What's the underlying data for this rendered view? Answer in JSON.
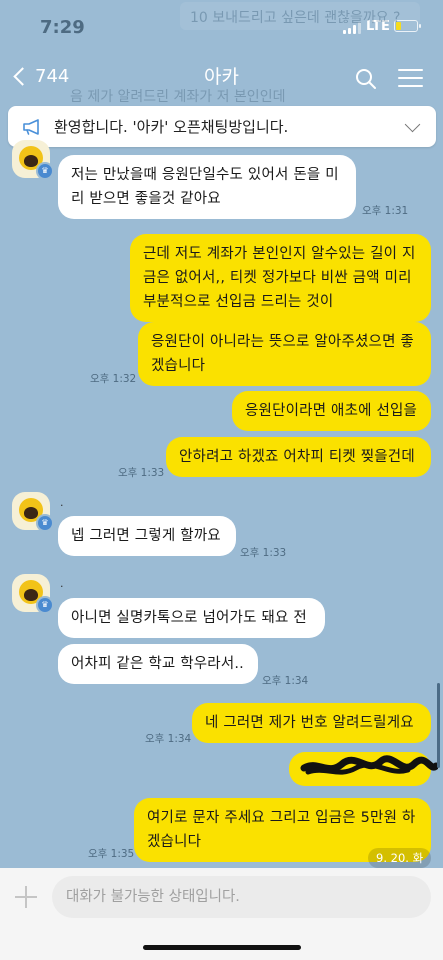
{
  "status_bar": {
    "time": "7:29",
    "network": "LTE"
  },
  "background_ghost": {
    "top_text": "10 보내드리고 싶은데 괜찮을까요 ?",
    "mid_text": "음 제가 알려드린 계좌가 저 본인인데"
  },
  "nav": {
    "back_count": "744",
    "title": "아카"
  },
  "notice": {
    "text": "환영합니다. '아카' 오픈채팅방입니다."
  },
  "messages": {
    "m1": {
      "text": "저는 만났을때 응원단일수도 있어서 돈을 미리 받으면 좋을것 같아요",
      "time": "오후 1:31"
    },
    "m2": {
      "text": "근데 저도 계좌가 본인인지 알수있는 길이 지금은 없어서,, 티켓 정가보다 비싼 금액 미리 부분적으로 선입금 드리는 것이"
    },
    "m3": {
      "text": "응원단이 아니라는 뜻으로 알아주셨으면 좋겠습니다",
      "time": "오후 1:32"
    },
    "m4": {
      "text": "응원단이라면 애초에 선입을"
    },
    "m5": {
      "text": "안하려고 하겠죠 어차피 티켓 찢을건데",
      "time": "오후 1:33"
    },
    "m6": {
      "sender": ".",
      "text": "넵 그러면 그렇게 할까요",
      "time": "오후 1:33"
    },
    "m7": {
      "sender": ".",
      "text": "아니면 실명카톡으로 넘어가도 돼요 전"
    },
    "m8": {
      "text": "어차피 같은 학교 학우라서..",
      "time": "오후 1:34"
    },
    "m9": {
      "text": "네 그러면 제가 번호 알려드릴게요",
      "time": "오후 1:34"
    },
    "m10": {
      "text": "여기로 문자 주세요 그리고 입금은 5만원 하겠습니다",
      "time": "오후 1:35"
    }
  },
  "date_chip": "9. 20. 화",
  "input": {
    "placeholder": "대화가 불가능한 상태입니다."
  },
  "colors": {
    "background": "#9bbbd4",
    "outgoing_bubble": "#fae100",
    "incoming_bubble": "#ffffff"
  }
}
